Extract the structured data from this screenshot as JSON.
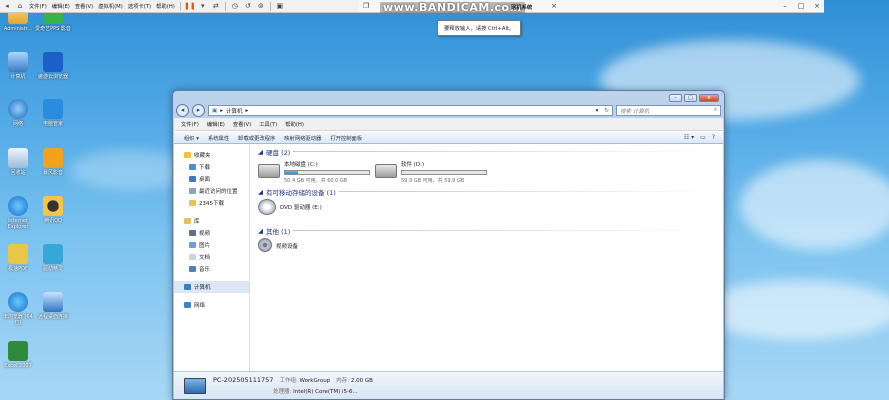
{
  "desktop": {
    "icons": [
      {
        "label": "Administr..."
      },
      {
        "label": "爱奇艺PPS 影音"
      },
      {
        "label": "计算机"
      },
      {
        "label": "傲游云浏览器"
      },
      {
        "label": "网络"
      },
      {
        "label": "电脑管家"
      },
      {
        "label": "回收站"
      },
      {
        "label": "暴风影音"
      },
      {
        "label": "Internet Explorer"
      },
      {
        "label": "腾讯QQ"
      },
      {
        "label": "极速PDF"
      },
      {
        "label": "驱动精灵"
      },
      {
        "label": "IE浏览器 (64位)"
      },
      {
        "label": "远程桌面连接"
      },
      {
        "label": "Excel 2007"
      }
    ]
  },
  "vm_toolbar": {
    "items": [
      "文件(F)",
      "编辑(E)",
      "查看(V)",
      "虚拟机(M)",
      "选项卡(T)",
      "帮助(H)"
    ]
  },
  "title_strip": {
    "watermark": "www.BANDICAM.com",
    "title": "网机系统"
  },
  "tooltip": {
    "text": "要释放输入，请按 Ctrl+Alt。"
  },
  "explorer": {
    "address": "计算机",
    "search_placeholder": "搜索 计算机",
    "menu": [
      "文件(F)",
      "编辑(E)",
      "查看(V)",
      "工具(T)",
      "帮助(H)"
    ],
    "commands": [
      "组织 ▾",
      "系统属性",
      "卸载或更改程序",
      "映射网络驱动器",
      "打开控制面板"
    ],
    "nav": {
      "favorites": "收藏夹",
      "fav_items": [
        "下载",
        "桌面",
        "最近访问的位置",
        "2345下载"
      ],
      "library": "库",
      "lib_items": [
        "视频",
        "图片",
        "文档",
        "音乐"
      ],
      "computer": "计算机",
      "network": "网络"
    },
    "sections": {
      "hdd": "硬盘 (2)",
      "removable": "有可移动存储的设备 (1)",
      "other": "其他 (1)"
    },
    "drives": [
      {
        "name": "本地磁盘 (C:)",
        "free": "50.4 GB 可用，共 60.0 GB",
        "used_fraction": 0.16
      },
      {
        "name": "软件 (D:)",
        "free": "59.9 GB 可用，共 59.9 GB",
        "used_fraction": 0.0
      }
    ],
    "dvd": {
      "name": "DVD 驱动器 (E:)"
    },
    "camera": {
      "name": "视频设备"
    },
    "status": {
      "pc_name": "PC-202505111757",
      "workgroup_label": "工作组:",
      "workgroup": "WorkGroup",
      "memory_label": "内存:",
      "memory": "2.00 GB",
      "cpu_label": "处理器:",
      "cpu": "Intel(R) Core(TM) i5-6..."
    }
  }
}
